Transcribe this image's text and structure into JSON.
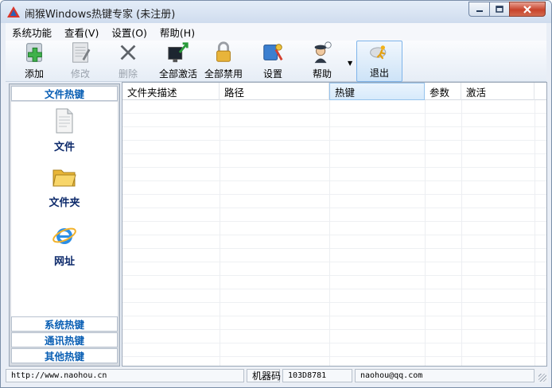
{
  "window": {
    "title": "闹猴Windows热键专家 (未注册)",
    "controls": {
      "minimize": "–",
      "maximize": "□",
      "close": "✕"
    }
  },
  "menu": [
    {
      "label": "系统功能"
    },
    {
      "label": "查看(V)"
    },
    {
      "label": "设置(O)"
    },
    {
      "label": "帮助(H)"
    }
  ],
  "toolbar": {
    "add": "添加",
    "edit": "修改",
    "delete": "删除",
    "activate_all": "全部激活",
    "disable_all": "全部禁用",
    "settings": "设置",
    "help": "帮助",
    "exit": "退出"
  },
  "sidebar": {
    "header": "文件热键",
    "entries": {
      "file": "文件",
      "folder": "文件夹",
      "url": "网址"
    },
    "tabs": {
      "system": "系统热键",
      "comm": "通讯热键",
      "other": "其他热键"
    }
  },
  "table": {
    "columns": [
      "文件夹描述",
      "路径",
      "热键",
      "参数",
      "激活"
    ],
    "rows": []
  },
  "status": {
    "url": "http://www.naohou.cn",
    "machine_label": "机器码",
    "machine_code": "103D8781",
    "email": "naohou@qq.com"
  },
  "colors": {
    "accent": "#0a5fb4",
    "sidebar_label": "#0d2a6b",
    "active_column": "#d7eafb"
  },
  "icons": {
    "add": "add-plus-icon",
    "edit": "edit-document-icon",
    "delete": "delete-x-icon",
    "activate_all": "activate-monitor-icon",
    "disable_all": "padlock-icon",
    "settings": "settings-tools-icon",
    "help": "help-person-icon",
    "exit": "exit-running-icon"
  }
}
